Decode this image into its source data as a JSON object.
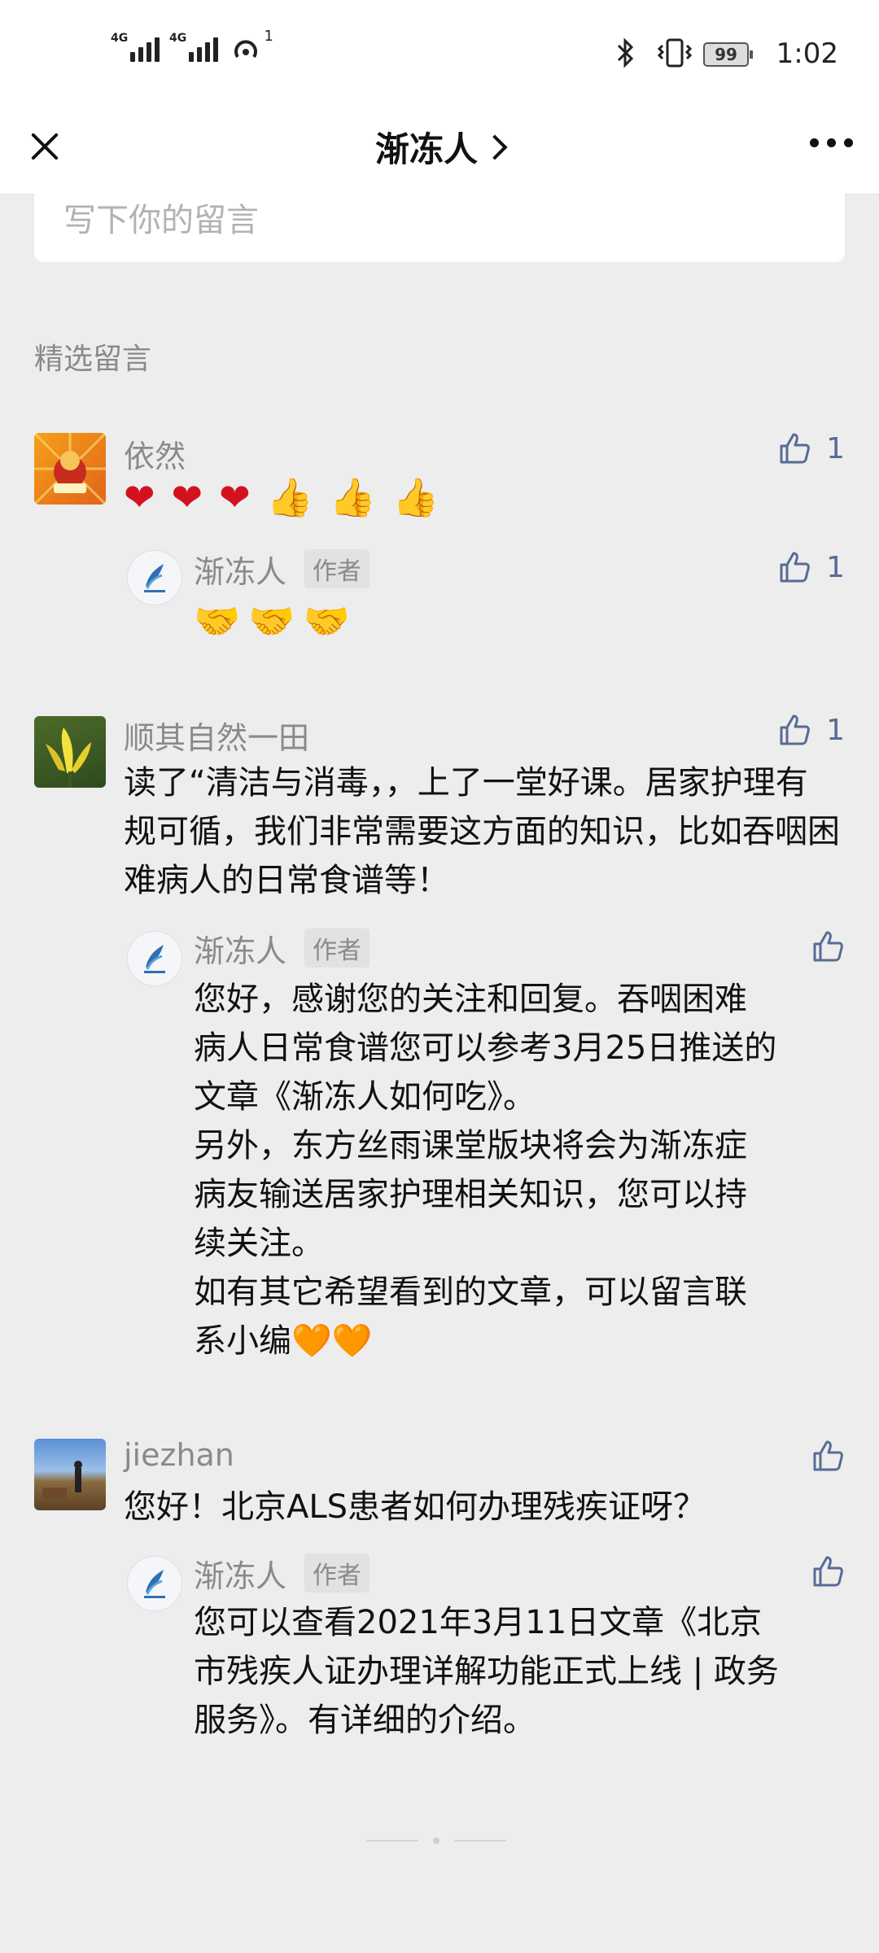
{
  "status": {
    "network1": "4G",
    "network2": "4G",
    "hotspot_count": "1",
    "battery": "99",
    "time": "1:02"
  },
  "nav": {
    "title": "渐冻人"
  },
  "input": {
    "placeholder": "写下你的留言"
  },
  "section": {
    "title": "精选留言"
  },
  "comments": [
    {
      "name": "依然",
      "text": "❤️ ❤️ ❤️ 👍 👍 👍",
      "likes": "1",
      "reply": {
        "name": "渐冻人",
        "badge": "作者",
        "text": "🤝🤝🤝",
        "likes": "1"
      }
    },
    {
      "name": "顺其自然一田",
      "text": "读了“清洁与消毒，，上了一堂好课。居家护理有规可循，我们非常需要这方面的知识，比如吞咽困难病人的日常食谱等！",
      "likes": "1",
      "reply": {
        "name": "渐冻人",
        "badge": "作者",
        "text_lines": [
          "您好，感谢您的关注和回复。吞咽困难",
          "病人日常食谱您可以参考3月25日推送的",
          "文章《渐冻人如何吃》。",
          "另外，东方丝雨课堂版块将会为渐冻症",
          "病友输送居家护理相关知识，您可以持",
          "续关注。",
          "如有其它希望看到的文章，可以留言联",
          "系小编🧡🧡"
        ]
      }
    },
    {
      "name": "jiezhan",
      "text": "您好！北京ALS患者如何办理残疾证呀？",
      "reply": {
        "name": "渐冻人",
        "badge": "作者",
        "text_lines": [
          "您可以查看2021年3月11日文章《北京",
          "市残疾人证办理详解功能正式上线 | 政务",
          "服务》。有详细的介绍。"
        ]
      }
    }
  ],
  "icons": {
    "like": "thumbs-up-icon",
    "close": "close-icon",
    "more": "more-icon"
  },
  "colors": {
    "like_blue": "#576b95",
    "background": "#ededed",
    "name_gray": "#8a8a8a"
  }
}
